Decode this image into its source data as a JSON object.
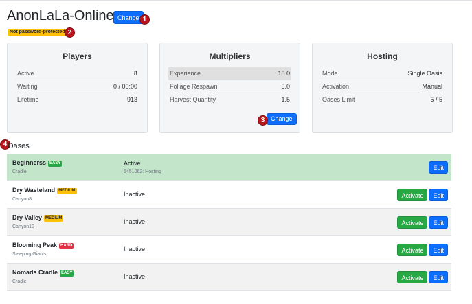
{
  "server": {
    "title": "AnonLaLa-Online",
    "change_label": "Change",
    "password_badge": "Not password-protected"
  },
  "markers": [
    "1",
    "2",
    "3",
    "4"
  ],
  "players": {
    "title": "Players",
    "rows": [
      {
        "label": "Active",
        "value": "8"
      },
      {
        "label": "Waiting",
        "value": "0 / 00:00"
      },
      {
        "label": "Lifetime",
        "value": "913"
      }
    ]
  },
  "multipliers": {
    "title": "Multipliers",
    "rows": [
      {
        "label": "Experience",
        "value": "10.0"
      },
      {
        "label": "Foliage Respawn",
        "value": "5.0"
      },
      {
        "label": "Harvest Quantity",
        "value": "1.5"
      }
    ],
    "change_label": "Change"
  },
  "hosting": {
    "title": "Hosting",
    "rows": [
      {
        "label": "Mode",
        "value": "Single Oasis"
      },
      {
        "label": "Activation",
        "value": "Manual"
      },
      {
        "label": "Oases Limit",
        "value": "5 / 5"
      }
    ]
  },
  "oases": {
    "heading": "Oases",
    "activate_label": "Activate",
    "edit_label": "Edit",
    "rows": [
      {
        "name": "Beginnerss",
        "difficulty": "EASY",
        "map": "Cradle",
        "status": "Active",
        "detail": "5451062: Hosting"
      },
      {
        "name": "Dry Wasteland",
        "difficulty": "MEDIUM",
        "map": "Canyon8",
        "status": "Inactive"
      },
      {
        "name": "Dry Valley",
        "difficulty": "MEDIUM",
        "map": "Canyon10",
        "status": "Inactive"
      },
      {
        "name": "Blooming Peak",
        "difficulty": "HARD",
        "map": "Sleeping Giants",
        "status": "Inactive"
      },
      {
        "name": "Nomads Cradle",
        "difficulty": "EASY",
        "map": "Cradle",
        "status": "Inactive"
      }
    ]
  },
  "colors": {
    "primary": "#0d6efd",
    "success": "#28a745",
    "warning": "#ffc107",
    "danger": "#dc3545",
    "active_row": "#c3e6cb",
    "alt_row": "#f2f2f2",
    "marker": "#b8161b"
  }
}
